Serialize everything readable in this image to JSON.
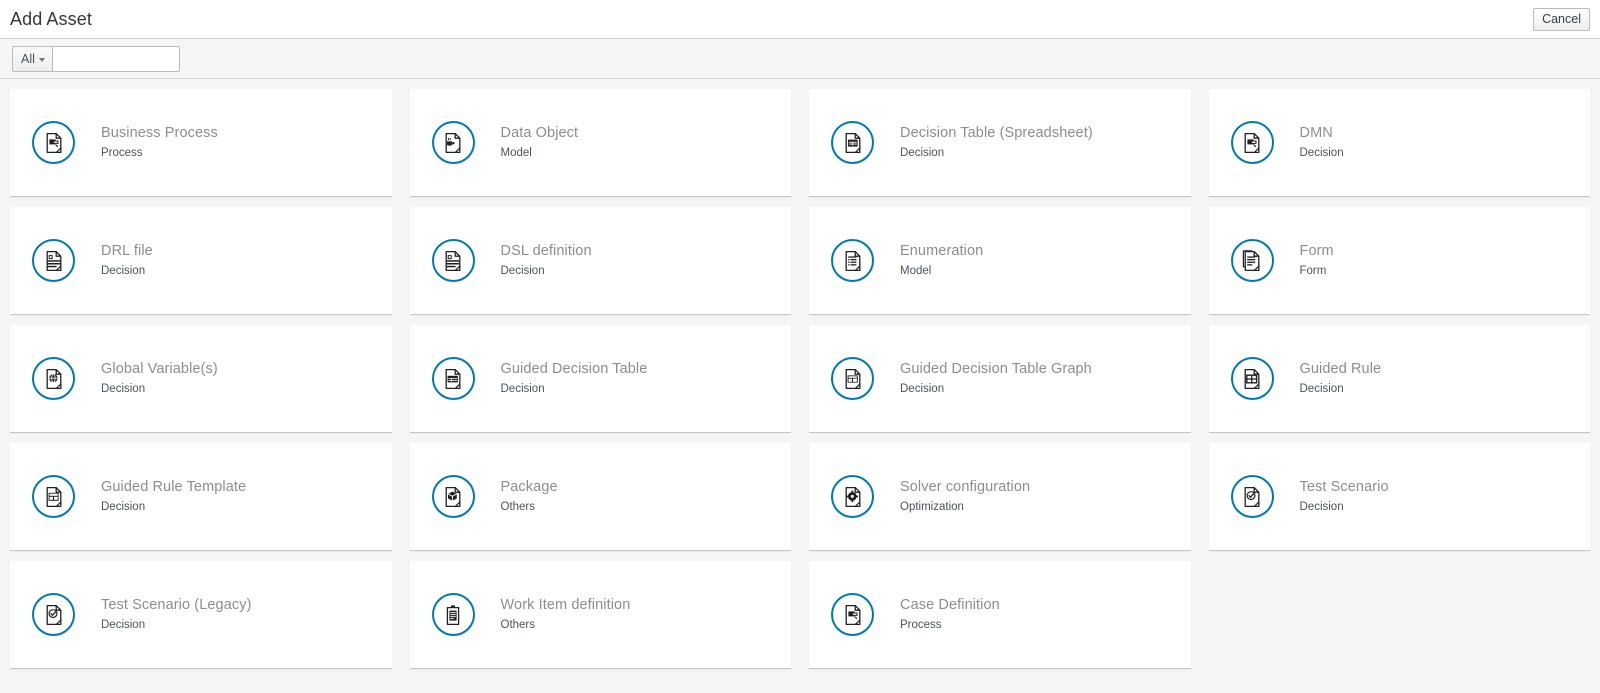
{
  "header": {
    "title": "Add Asset",
    "cancel_label": "Cancel"
  },
  "filter_bar": {
    "type_filter_label": "All",
    "search_value": "",
    "search_placeholder": ""
  },
  "colors": {
    "icon_ring": "#0079b3",
    "page_background": "#f5f5f5",
    "card_background": "#ffffff",
    "title_text": "#8b8d8f",
    "category_text": "#4d5258"
  },
  "assets": [
    {
      "title": "Business Process",
      "category": "Process",
      "icon": "process-document-icon"
    },
    {
      "title": "Data Object",
      "category": "Model",
      "icon": "java-object-document-icon"
    },
    {
      "title": "Decision Table (Spreadsheet)",
      "category": "Decision",
      "icon": "spreadsheet-document-icon"
    },
    {
      "title": "DMN",
      "category": "Decision",
      "icon": "process-document-icon"
    },
    {
      "title": "DRL file",
      "category": "Decision",
      "icon": "rule-file-document-icon"
    },
    {
      "title": "DSL definition",
      "category": "Decision",
      "icon": "rule-file-document-icon"
    },
    {
      "title": "Enumeration",
      "category": "Model",
      "icon": "list-document-icon"
    },
    {
      "title": "Form",
      "category": "Form",
      "icon": "form-document-icon"
    },
    {
      "title": "Global Variable(s)",
      "category": "Decision",
      "icon": "globe-document-icon"
    },
    {
      "title": "Guided Decision Table",
      "category": "Decision",
      "icon": "table-document-icon"
    },
    {
      "title": "Guided Decision Table Graph",
      "category": "Decision",
      "icon": "table-graph-document-icon"
    },
    {
      "title": "Guided Rule",
      "category": "Decision",
      "icon": "grid-document-icon"
    },
    {
      "title": "Guided Rule Template",
      "category": "Decision",
      "icon": "template-document-icon"
    },
    {
      "title": "Package",
      "category": "Others",
      "icon": "package-document-icon"
    },
    {
      "title": "Solver configuration",
      "category": "Optimization",
      "icon": "gear-document-icon"
    },
    {
      "title": "Test Scenario",
      "category": "Decision",
      "icon": "check-circle-document-icon"
    },
    {
      "title": "Test Scenario (Legacy)",
      "category": "Decision",
      "icon": "check-circle-document-icon"
    },
    {
      "title": "Work Item definition",
      "category": "Others",
      "icon": "clipboard-icon"
    },
    {
      "title": "Case Definition",
      "category": "Process",
      "icon": "process-document-icon"
    }
  ]
}
